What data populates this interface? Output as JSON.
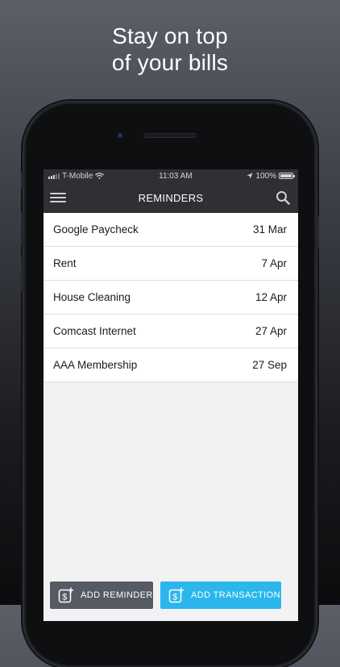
{
  "headline": {
    "line1": "Stay on top",
    "line2": "of your bills"
  },
  "status_bar": {
    "carrier": "T-Mobile",
    "time": "11:03 AM",
    "battery": "100%"
  },
  "navbar": {
    "title": "REMINDERS",
    "menu_icon": "hamburger-menu-icon",
    "search_icon": "search-icon"
  },
  "reminders": [
    {
      "name": "Google Paycheck",
      "date": "31 Mar"
    },
    {
      "name": "Rent",
      "date": "7 Apr"
    },
    {
      "name": "House Cleaning",
      "date": "12 Apr"
    },
    {
      "name": "Comcast Internet",
      "date": "27 Apr"
    },
    {
      "name": "AAA Membership",
      "date": "27 Sep"
    }
  ],
  "buttons": {
    "add_reminder": "ADD REMINDER",
    "add_transaction": "ADD TRANSACTION"
  },
  "colors": {
    "navbar": "#2e3033",
    "add_reminder_bg": "#555a63",
    "add_transaction_bg": "#2bb6ec"
  }
}
